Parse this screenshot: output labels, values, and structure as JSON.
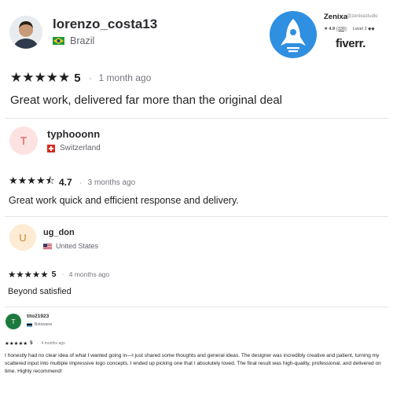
{
  "reviews": [
    {
      "username": "lorenzo_costa13",
      "country": "Brazil",
      "flag": "brazil-flag-icon",
      "avatar_kind": "photo",
      "stars": "★★★★★",
      "rating": "5",
      "time_ago": "1 month ago",
      "text": "Great work, delivered far more than the original deal"
    },
    {
      "username": "typhooonn",
      "country": "Switzerland",
      "flag": "switzerland-flag-icon",
      "avatar_letter": "T",
      "avatar_bg": "#fde2e2",
      "avatar_fg": "#d9534f",
      "stars": "★★★★⯪",
      "rating": "4.7",
      "time_ago": "3 months ago",
      "text": "Great work quick and efficient response and delivery."
    },
    {
      "username": "ug_don",
      "country": "United States",
      "flag": "united-states-flag-icon",
      "avatar_letter": "U",
      "avatar_bg": "#fdebd3",
      "avatar_fg": "#c88a3a",
      "stars": "★★★★★",
      "rating": "5",
      "time_ago": "4 months ago",
      "text": "Beyond satisfied"
    },
    {
      "username": "tito21923",
      "country": "Botswana",
      "flag": "botswana-flag-icon",
      "avatar_letter": "T",
      "avatar_bg": "#1d7a3e",
      "avatar_fg": "#ffffff",
      "stars": "★★★★★",
      "rating": "5",
      "time_ago": "4 months ago",
      "text": "I honestly had no clear idea of what I wanted going in—I just shared some thoughts and general ideas. The designer was incredibly creative and patient, turning my scattered input into multiple impressive logo concepts. I ended up picking one that I absolutely loved. The final result was high-quality, professional, and delivered on time. Highly recommend!"
    }
  ],
  "dot": "·",
  "seller_card": {
    "name": "Zenixa",
    "handle": "@zenixastudio",
    "rating": "4.9",
    "count": "(336)",
    "level": "Level 2 ◆◆",
    "logo": "rocket-icon",
    "platform": "fiverr."
  },
  "colors": {
    "logo_bg": "#2f8fe0",
    "fiverr_text": "#222222"
  }
}
